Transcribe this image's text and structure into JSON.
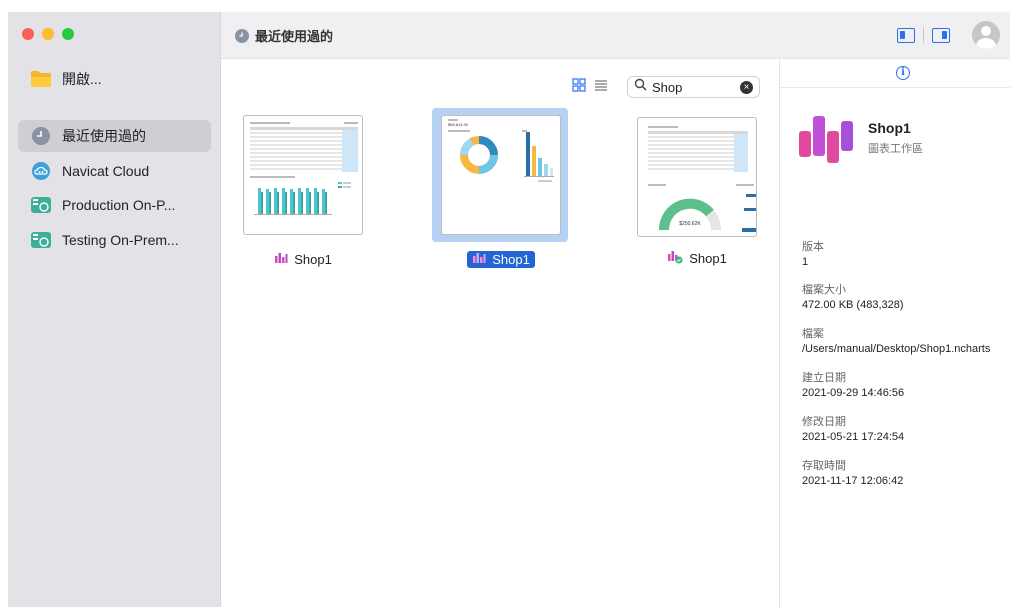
{
  "sidebar": {
    "items": [
      {
        "label": "開啟...",
        "icon": "folder-icon"
      },
      {
        "label": "最近使用過的",
        "icon": "clock-icon"
      },
      {
        "label": "Navicat Cloud",
        "icon": "cloud-icon"
      },
      {
        "label": "Production On-P...",
        "icon": "server-icon"
      },
      {
        "label": "Testing On-Prem...",
        "icon": "server-icon"
      }
    ]
  },
  "toolbar": {
    "title": "最近使用過的"
  },
  "search": {
    "value": "Shop",
    "clear": "×"
  },
  "files": [
    {
      "name": "Shop1",
      "selected": false
    },
    {
      "name": "Shop1",
      "selected": true
    },
    {
      "name": "Shop1",
      "selected": false
    }
  ],
  "thumbnails": {
    "card2_amount": "$56,614.00",
    "card3_gauge_value": "$250.62K"
  },
  "info": {
    "name": "Shop1",
    "type": "圖表工作區",
    "fields": [
      {
        "key": "版本",
        "value": "1"
      },
      {
        "key": "檔案大小",
        "value": "472.00 KB (483,328)"
      },
      {
        "key": "檔案",
        "value": "/Users/manual/Desktop/Shop1.ncharts"
      },
      {
        "key": "建立日期",
        "value": "2021-09-29 14:46:56"
      },
      {
        "key": "修改日期",
        "value": "2021-05-21 17:24:54"
      },
      {
        "key": "存取時間",
        "value": "2021-11-17 12:06:42"
      }
    ]
  },
  "colors": {
    "accent": "#2c6ff0",
    "selection": "#b5d2f5",
    "sidebar_bg": "#e3e2e7"
  }
}
